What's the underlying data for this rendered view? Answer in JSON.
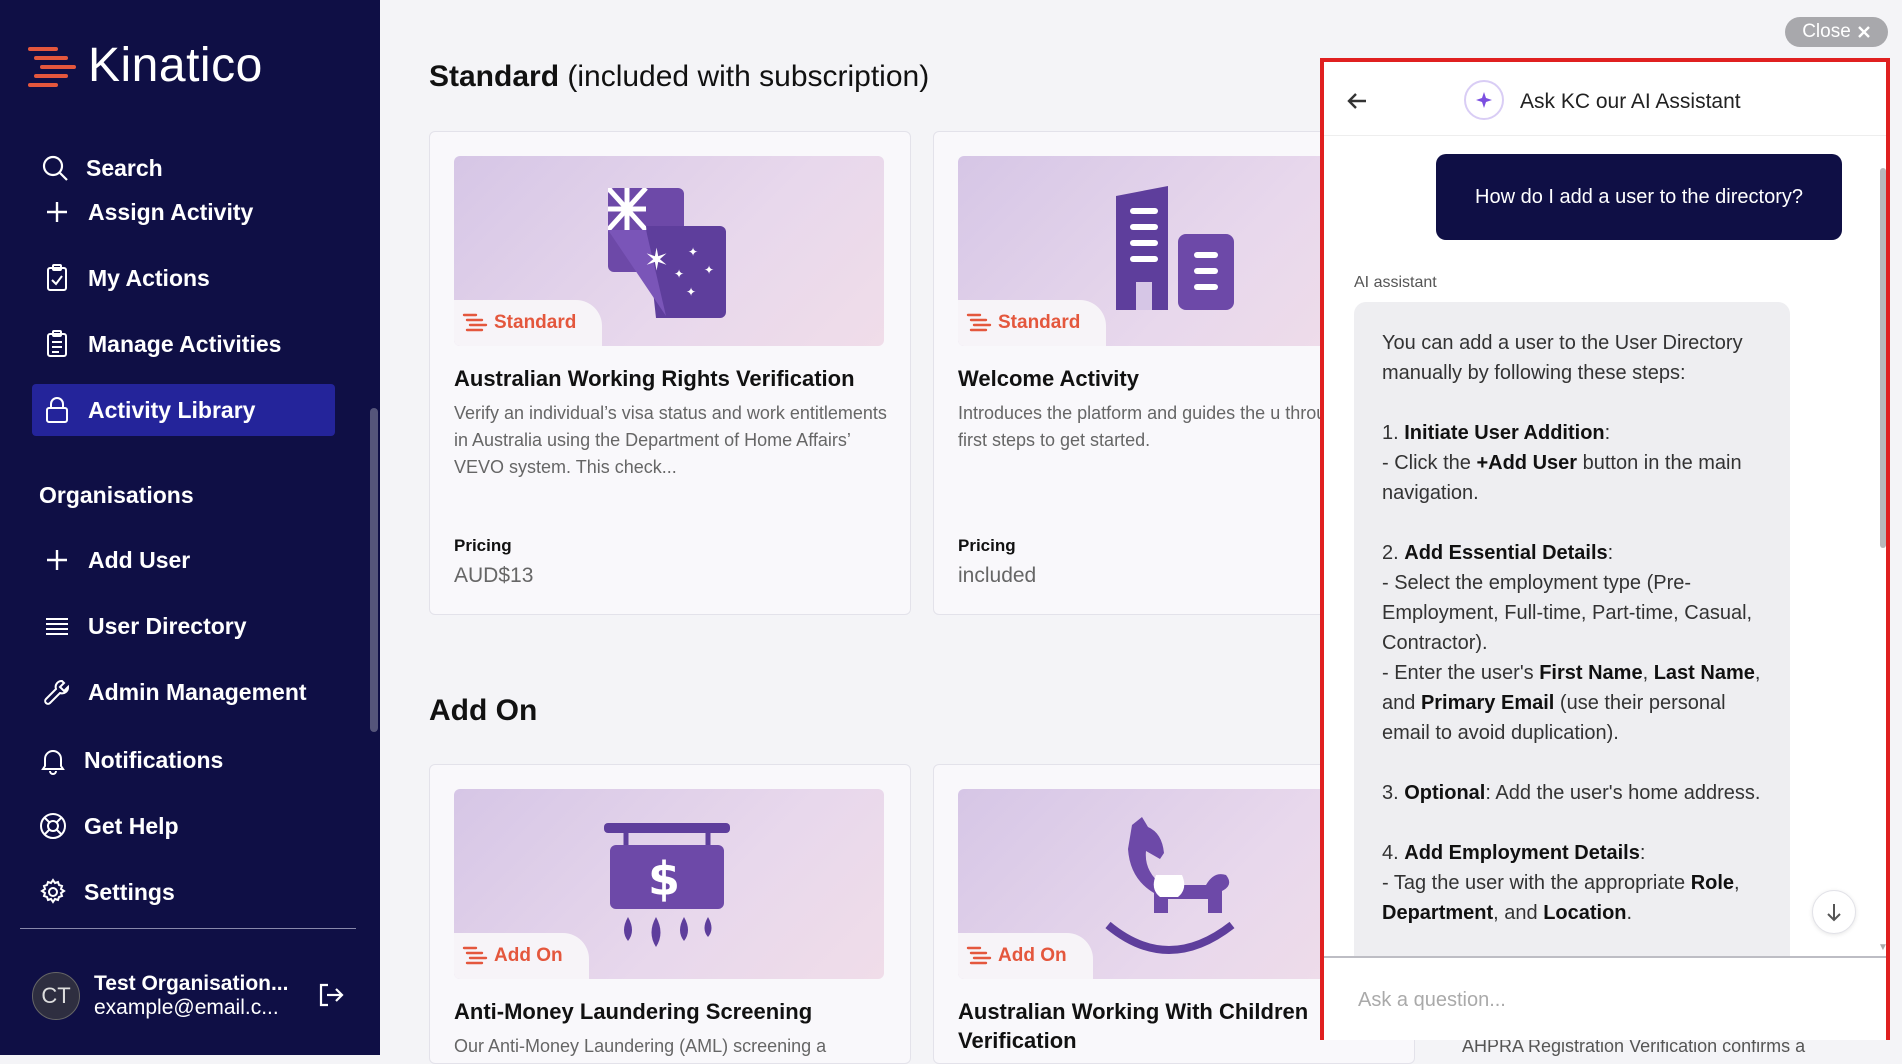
{
  "brand": {
    "name": "Kinatico",
    "accent": "#e4573d",
    "sidebar_bg": "#0f0f45"
  },
  "sidebar": {
    "items_top": [
      {
        "label": "Search",
        "icon": "search-icon"
      },
      {
        "label": "Assign Activity",
        "icon": "plus-icon"
      },
      {
        "label": "My Actions",
        "icon": "clipboard-check-icon"
      },
      {
        "label": "Manage Activities",
        "icon": "clipboard-list-icon"
      },
      {
        "label": "Activity Library",
        "icon": "lock-icon",
        "active": true
      }
    ],
    "section_label": "Organisations",
    "items_org": [
      {
        "label": "Add User",
        "icon": "plus-icon"
      },
      {
        "label": "User Directory",
        "icon": "list-icon"
      },
      {
        "label": "Admin Management",
        "icon": "wrench-icon"
      },
      {
        "label": "Notifications",
        "icon": "bell-icon"
      },
      {
        "label": "Get Help",
        "icon": "lifebuoy-icon"
      },
      {
        "label": "Settings",
        "icon": "gear-icon"
      }
    ],
    "user": {
      "initials": "CT",
      "name": "Test Organisation...",
      "email": "example@email.c..."
    }
  },
  "main": {
    "standard_heading_bold": "Standard",
    "standard_heading_rest": " (included with subscription)",
    "addon_heading": "Add On",
    "pricing_label": "Pricing",
    "standard_cards": [
      {
        "badge": "Standard",
        "title": "Australian Working Rights Verification",
        "desc": "Verify an individual’s visa status and work entitlements in Australia using the Department of Home Affairs’ VEVO system. This check...",
        "price": "AUD$13",
        "icon": "flag-icon"
      },
      {
        "badge": "Standard",
        "title": "Welcome Activity",
        "desc": "Introduces the platform and guides the u through their first steps to get started.",
        "price": "included",
        "icon": "building-icon"
      }
    ],
    "addon_cards": [
      {
        "badge": "Add On",
        "title": "Anti-Money Laundering Screening",
        "desc": "Our Anti-Money Laundering (AML) screening a",
        "icon": "money-sign-icon"
      },
      {
        "badge": "Add On",
        "title": "Australian Working With Children Verification",
        "icon": "rocking-horse-icon"
      }
    ],
    "behind_text": "AHPRA Registration Verification confirms a"
  },
  "close_label": "Close",
  "ai_panel": {
    "title": "Ask KC our AI Assistant",
    "user_message": "How do I add a user to the directory?",
    "assistant_label": "AI assistant",
    "input_placeholder": "Ask a question...",
    "response": {
      "intro": "You can add a user to the User Directory manually by following these steps:",
      "s1_num": "1. ",
      "s1_title": "Initiate User Addition",
      "s1_colon": ":",
      "s1_a": "- Click the ",
      "s1_b": "+Add User",
      "s1_c": " button in the main navigation.",
      "s2_num": "2. ",
      "s2_title": "Add Essential Details",
      "s2_colon": ":",
      "s2_a": "- Select the employment type (Pre-Employment, Full-time, Part-time, Casual, Contractor).",
      "s2_b": "- Enter the user's ",
      "s2_b1": "First Name",
      "s2_b2": ", ",
      "s2_b3": "Last Name",
      "s2_b4": ", and ",
      "s2_b5": "Primary Email",
      "s2_b6": " (use their personal email to avoid duplication).",
      "s3_num": "3. ",
      "s3_title": "Optional",
      "s3_rest": ": Add the user's home address.",
      "s4_num": "4. ",
      "s4_title": "Add Employment Details",
      "s4_colon": ":",
      "s4_a": "- Tag the user with the appropriate ",
      "s4_b": "Role",
      "s4_c": ", ",
      "s4_d": "Department",
      "s4_e": ", and ",
      "s4_f": "Location",
      "s4_g": "."
    }
  }
}
